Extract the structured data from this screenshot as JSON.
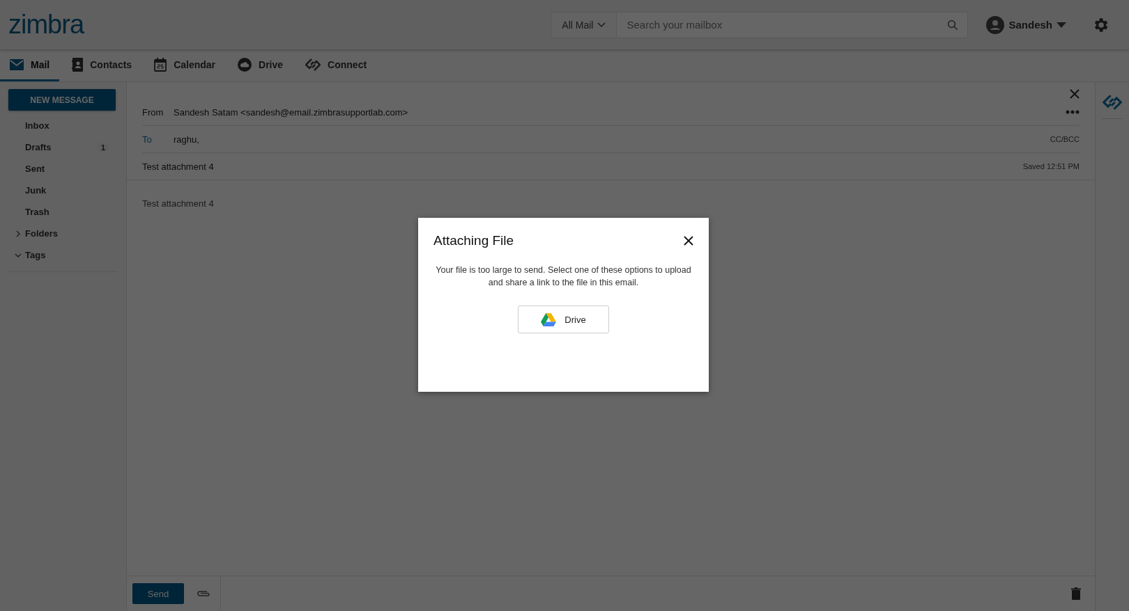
{
  "header": {
    "logo": "zimbra",
    "search_scope": "All Mail",
    "search": {
      "placeholder": "Search your mailbox"
    },
    "user": "Sandesh"
  },
  "tabs": [
    {
      "label": "Mail",
      "selected": true
    },
    {
      "label": "Contacts",
      "selected": false
    },
    {
      "label": "Calendar",
      "selected": false
    },
    {
      "label": "Drive",
      "selected": false
    },
    {
      "label": "Connect",
      "selected": false
    }
  ],
  "sidebar": {
    "new_message": "NEW MESSAGE",
    "items": [
      {
        "label": "Inbox",
        "kind": "folder"
      },
      {
        "label": "Drafts",
        "kind": "folder",
        "count": "1"
      },
      {
        "label": "Sent",
        "kind": "folder"
      },
      {
        "label": "Junk",
        "kind": "folder"
      },
      {
        "label": "Trash",
        "kind": "folder"
      },
      {
        "label": "Folders",
        "kind": "group",
        "expanded": false
      },
      {
        "label": "Tags",
        "kind": "group",
        "expanded": true
      }
    ]
  },
  "compose": {
    "from_label": "From",
    "from": "Sandesh Satam <sandesh@email.zimbrasupportlab.com>",
    "to_label": "To",
    "to": "raghu,",
    "cc_bcc": "CC/BCC",
    "subject": "Test attachment 4",
    "saved": "Saved 12:51 PM",
    "body": "Test attachment 4",
    "send": "Send"
  },
  "dialog": {
    "title": "Attaching File",
    "message": "Your file is too large to send. Select one of these options to upload and share a link to the file in this email.",
    "option": "Drive"
  }
}
